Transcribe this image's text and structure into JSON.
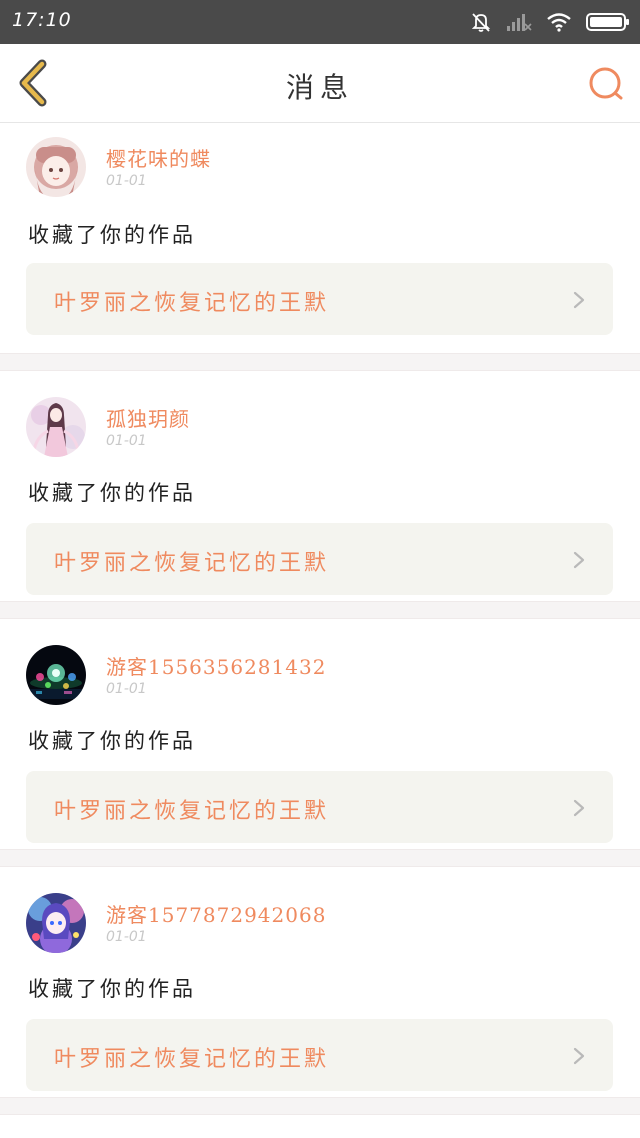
{
  "status_bar": {
    "time": "17:10",
    "icons": [
      "bell-muted-icon",
      "cellular-signal-icon",
      "wifi-icon",
      "battery-icon"
    ]
  },
  "header": {
    "title": "消息",
    "back_icon": "chevron-left-icon",
    "search_icon": "search-icon"
  },
  "theme": {
    "accent": "#ef8a5f",
    "back_icon_color": "#e6b94c",
    "card_background": "#f4f4ef",
    "divider": "#f6f4f4"
  },
  "messages": [
    {
      "user_name": "樱花味的蝶",
      "date": "01-01",
      "action": "收藏了你的作品",
      "work_title": "叶罗丽之恢复记忆的王默",
      "avatar_icon": "pink-anime-girl-avatar"
    },
    {
      "user_name": "孤独玥颜",
      "date": "01-01",
      "action": "收藏了你的作品",
      "work_title": "叶罗丽之恢复记忆的王默",
      "avatar_icon": "fairy-girl-avatar"
    },
    {
      "user_name": "游客1556356281432",
      "date": "01-01",
      "action": "收藏了你的作品",
      "work_title": "叶罗丽之恢复记忆的王默",
      "avatar_icon": "night-light-avatar"
    },
    {
      "user_name": "游客1577872942068",
      "date": "01-01",
      "action": "收藏了你的作品",
      "work_title": "叶罗丽之恢复记忆的王默",
      "avatar_icon": "colorful-girl-avatar"
    }
  ]
}
